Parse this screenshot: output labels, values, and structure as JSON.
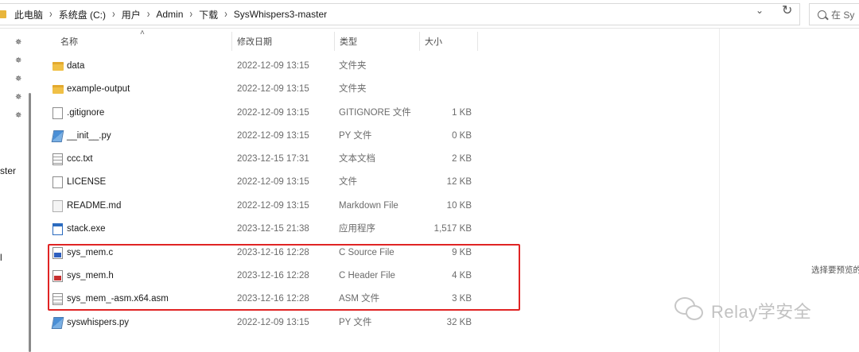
{
  "address_bar": {
    "breadcrumbs": [
      "此电脑",
      "系统盘 (C:)",
      "用户",
      "Admin",
      "下载",
      "SysWhispers3-master"
    ],
    "dropdown_icon": "chevron-down-icon",
    "refresh_icon": "refresh-icon",
    "search_placeholder": "在 Sy"
  },
  "nav_pane": {
    "pinned_count": 5,
    "labels": [
      "ster",
      "l"
    ]
  },
  "columns": {
    "name": "名称",
    "modified": "修改日期",
    "type": "类型",
    "size": "大小"
  },
  "files": [
    {
      "name": "data",
      "modified": "2022-12-09 13:15",
      "type": "文件夹",
      "size": "",
      "icon": "folder-icon"
    },
    {
      "name": "example-output",
      "modified": "2022-12-09 13:15",
      "type": "文件夹",
      "size": "",
      "icon": "folder-icon"
    },
    {
      "name": ".gitignore",
      "modified": "2022-12-09 13:15",
      "type": "GITIGNORE 文件",
      "size": "1 KB",
      "icon": "file-icon"
    },
    {
      "name": "__init__.py",
      "modified": "2022-12-09 13:15",
      "type": "PY 文件",
      "size": "0 KB",
      "icon": "python-file-icon"
    },
    {
      "name": "ccc.txt",
      "modified": "2023-12-15 17:31",
      "type": "文本文档",
      "size": "2 KB",
      "icon": "text-file-icon"
    },
    {
      "name": "LICENSE",
      "modified": "2022-12-09 13:15",
      "type": "文件",
      "size": "12 KB",
      "icon": "file-icon"
    },
    {
      "name": "README.md",
      "modified": "2022-12-09 13:15",
      "type": "Markdown File",
      "size": "10 KB",
      "icon": "markdown-file-icon"
    },
    {
      "name": "stack.exe",
      "modified": "2023-12-15 21:38",
      "type": "应用程序",
      "size": "1,517 KB",
      "icon": "exe-file-icon"
    },
    {
      "name": "sys_mem.c",
      "modified": "2023-12-16 12:28",
      "type": "C Source File",
      "size": "9 KB",
      "icon": "c-source-file-icon"
    },
    {
      "name": "sys_mem.h",
      "modified": "2023-12-16 12:28",
      "type": "C Header File",
      "size": "4 KB",
      "icon": "c-header-file-icon"
    },
    {
      "name": "sys_mem_-asm.x64.asm",
      "modified": "2023-12-16 12:28",
      "type": "ASM 文件",
      "size": "3 KB",
      "icon": "text-file-icon"
    },
    {
      "name": "syswhispers.py",
      "modified": "2022-12-09 13:15",
      "type": "PY 文件",
      "size": "32 KB",
      "icon": "python-file-icon"
    }
  ],
  "details_pane": {
    "hint": "选择要预览的"
  },
  "watermark": {
    "text": "Relay学安全"
  },
  "colors": {
    "highlight": "#e02424",
    "folder": "#f0c046"
  }
}
